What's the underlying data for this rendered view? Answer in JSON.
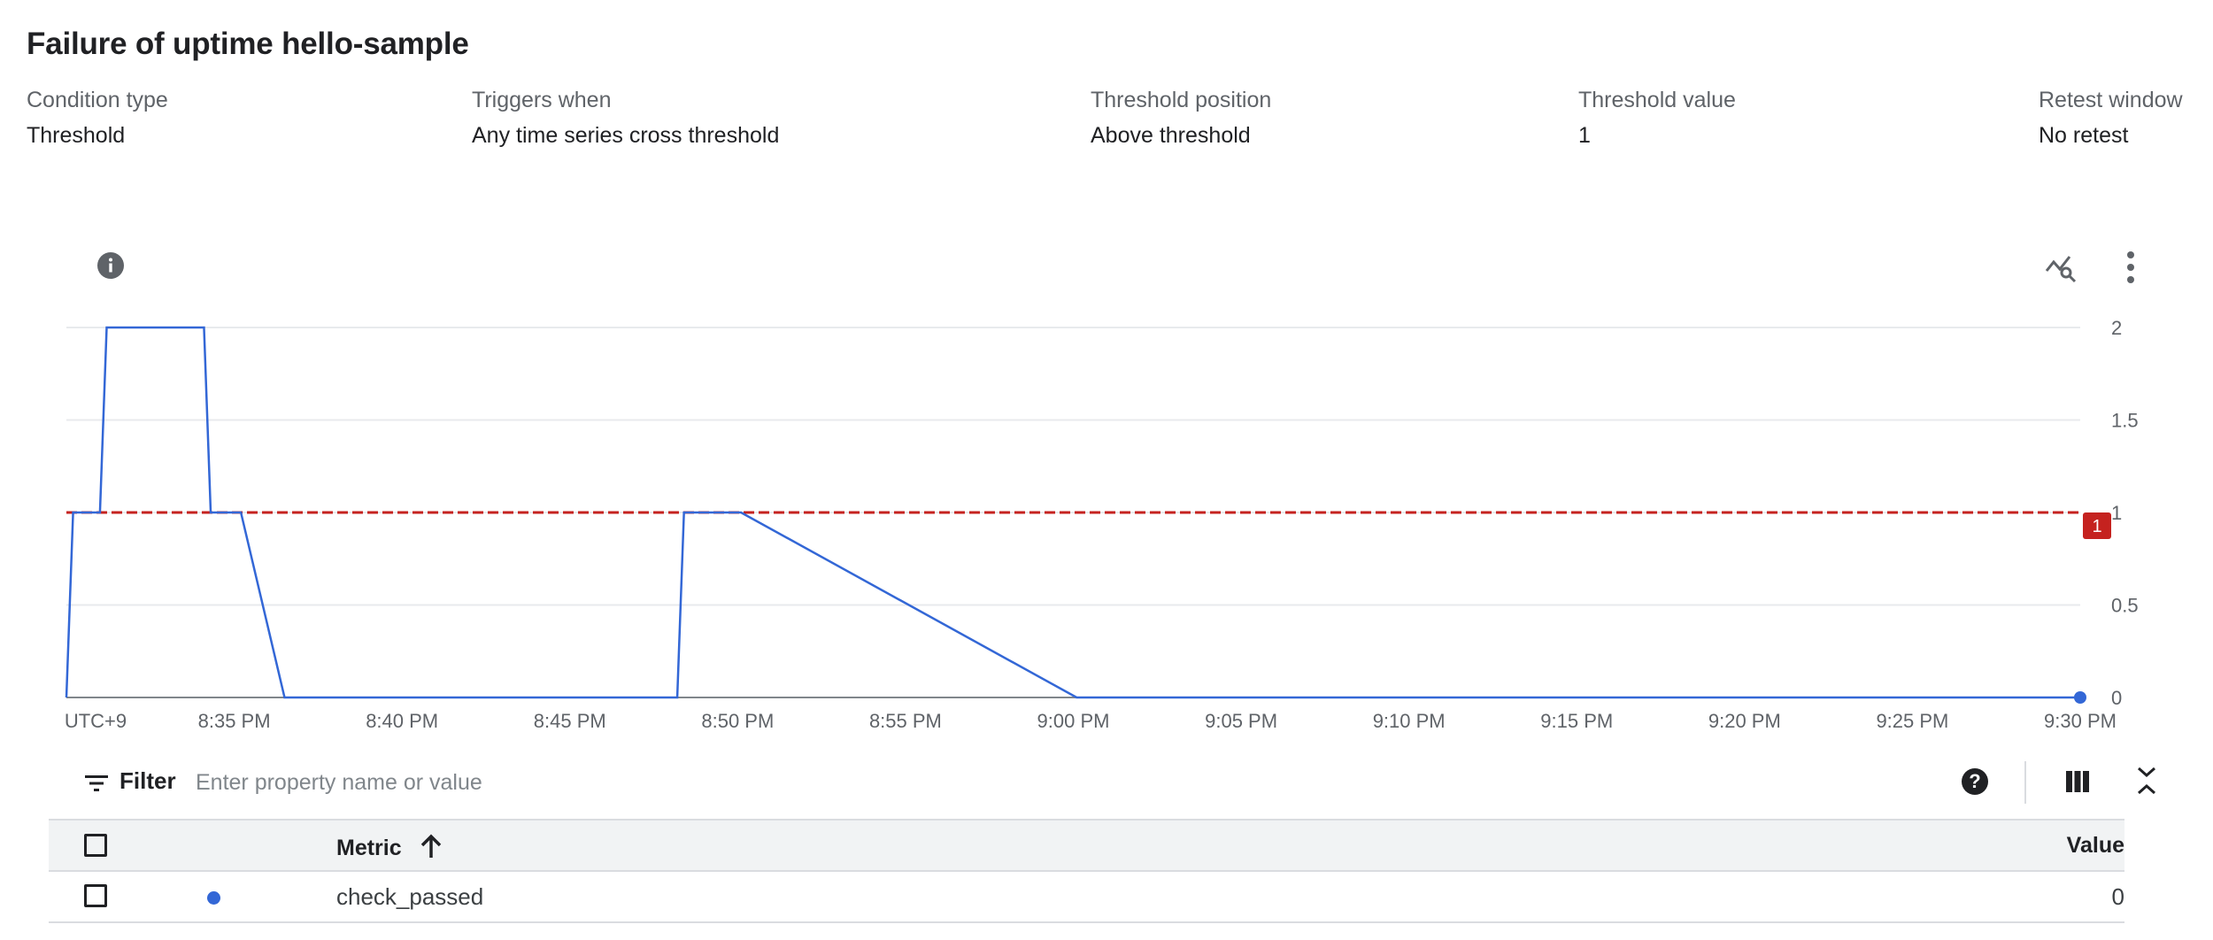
{
  "policy": {
    "title": "Failure of uptime hello-sample"
  },
  "conditions": [
    {
      "label": "Condition type",
      "value": "Threshold"
    },
    {
      "label": "Triggers when",
      "value": "Any time series cross threshold"
    },
    {
      "label": "Threshold position",
      "value": "Above threshold"
    },
    {
      "label": "Threshold value",
      "value": "1"
    },
    {
      "label": "Retest window",
      "value": "No retest"
    }
  ],
  "icons": {
    "info": "info-icon",
    "explore": "chart-explore-icon",
    "more": "more-vert-icon",
    "filter": "filter-icon",
    "help": "help-icon",
    "columns": "column-display-icon",
    "collapse": "collapse-icon",
    "sort": "arrow-upward-icon"
  },
  "colors": {
    "series": "#3367d6",
    "threshold": "#c5221f",
    "grid": "#e8eaed",
    "axis": "#5f6368"
  },
  "chart_data": {
    "type": "line",
    "x_tick_labels": [
      "UTC+9",
      "8:35 PM",
      "8:40 PM",
      "8:45 PM",
      "8:50 PM",
      "8:55 PM",
      "9:00 PM",
      "9:05 PM",
      "9:10 PM",
      "9:15 PM",
      "9:20 PM",
      "9:25 PM",
      "9:30 PM"
    ],
    "y_ticks": [
      0,
      0.5,
      1,
      1.5,
      2
    ],
    "y_tick_labels": [
      "0",
      "0.5",
      "1",
      "1.5",
      "2"
    ],
    "ylim": [
      0,
      2
    ],
    "xlim_minutes_after_830pm": [
      0,
      60
    ],
    "threshold": {
      "value": 1,
      "label": "1"
    },
    "series": [
      {
        "name": "check_passed",
        "x_minutes_after_830pm": [
          0,
          0.2,
          1.0,
          1.2,
          4.1,
          4.3,
          5.2,
          6.5,
          18.2,
          18.4,
          20.1,
          30.1,
          60
        ],
        "values": [
          0,
          1,
          1,
          2,
          2,
          1,
          1,
          0,
          0,
          1,
          1,
          0,
          0
        ]
      }
    ]
  },
  "filter": {
    "label": "Filter",
    "placeholder": "Enter property name or value"
  },
  "table": {
    "columns": {
      "metric": "Metric",
      "value": "Value"
    },
    "rows": [
      {
        "metric": "check_passed",
        "value": "0"
      }
    ]
  }
}
